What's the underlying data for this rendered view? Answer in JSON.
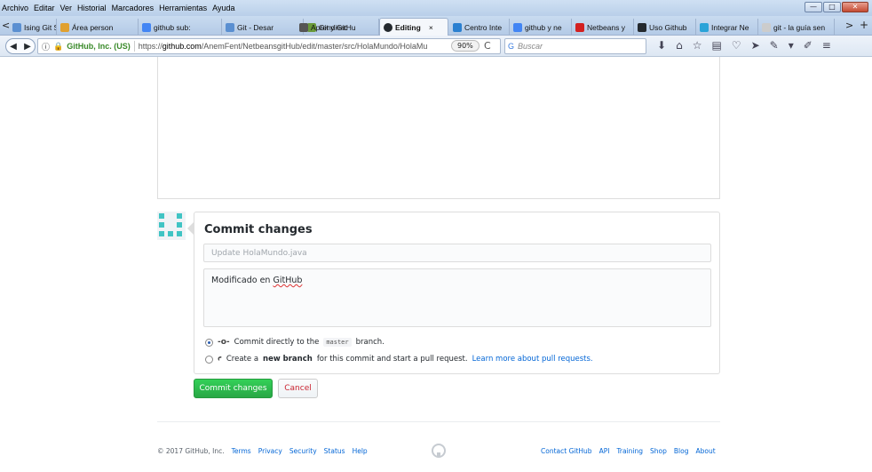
{
  "menubar": [
    "Archivo",
    "Editar",
    "Ver",
    "Historial",
    "Marcadores",
    "Herramientas",
    "Ayuda"
  ],
  "window_controls": {
    "minimize": "—",
    "maximize": "□",
    "close": "✕"
  },
  "tabs": [
    {
      "label": "Ising Git S",
      "icon_color": "#5a8fd1"
    },
    {
      "label": "Área person",
      "icon_color": "#e0a030"
    },
    {
      "label": "github sub:",
      "icon_color": "#4285f4"
    },
    {
      "label": "Git - Desar",
      "icon_color": "#5a8fd1"
    },
    {
      "label": "Git y GitHu",
      "icon_color": "#6a9a3a"
    },
    {
      "label": "Aprendien:",
      "icon_color": "#555555"
    },
    {
      "label": "Editing",
      "icon_color": "#24292e",
      "active": true,
      "close": "×"
    },
    {
      "label": "Centro Inte",
      "icon_color": "#2a7fd0"
    },
    {
      "label": "github y ne",
      "icon_color": "#4285f4"
    },
    {
      "label": "Netbeans y",
      "icon_color": "#d32020"
    },
    {
      "label": "Uso Github",
      "icon_color": "#24292e"
    },
    {
      "label": "Integrar Ne",
      "icon_color": "#2aa3d8"
    },
    {
      "label": "git - la guía sen",
      "icon_color": "#cccccc"
    }
  ],
  "tab_nav": {
    "prev": "<",
    "next": ">",
    "new": "+"
  },
  "nav": {
    "back": "◀",
    "forward": "▶",
    "site_identity": "GitHub, Inc. (US)",
    "url_prefix": "https://",
    "url_domain": "github.com",
    "url_path": "/AnemFent/NetbeansgitHub/edit/master/src/HolaMundo/HolaMu",
    "zoom": "90%",
    "reload": "C",
    "search_placeholder": "Buscar"
  },
  "commit": {
    "title": "Commit changes",
    "summary_placeholder": "Update HolaMundo.java",
    "description_before": "Modificado en ",
    "description_spell": "GitHub",
    "option_direct": {
      "prefix": "Commit directly to the",
      "branch": "master",
      "suffix": "branch."
    },
    "option_new": {
      "prefix": "Create a",
      "bold": "new branch",
      "middle": "for this commit and start a pull request.",
      "link": "Learn more about pull requests."
    },
    "commit_button": "Commit changes",
    "cancel_button": "Cancel"
  },
  "footer": {
    "copyright": "© 2017 GitHub, Inc.",
    "left_links": [
      "Terms",
      "Privacy",
      "Security",
      "Status",
      "Help"
    ],
    "right_links": [
      "Contact GitHub",
      "API",
      "Training",
      "Shop",
      "Blog",
      "About"
    ]
  },
  "colors": {
    "primary_button": "#28a745",
    "cancel_text": "#cb2431",
    "link": "#0366d6",
    "avatar": "#40c4c4"
  }
}
